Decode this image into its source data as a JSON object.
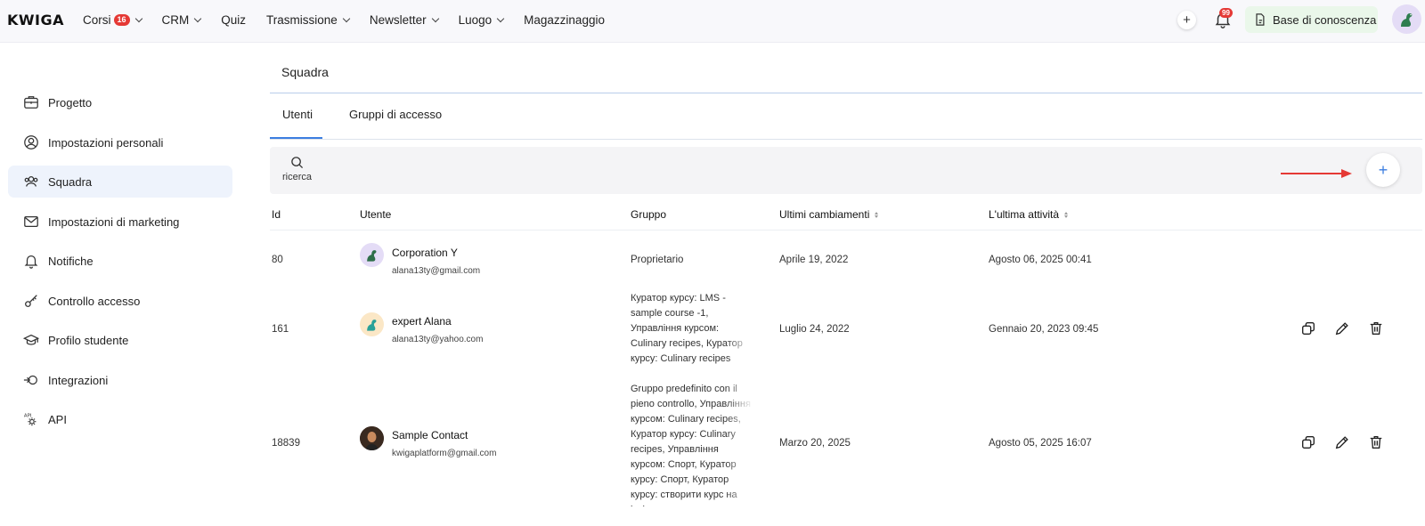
{
  "app": {
    "logo": "KWIGA"
  },
  "nav": {
    "items": [
      {
        "label": "Corsi",
        "badge": "16",
        "chevron": true
      },
      {
        "label": "CRM",
        "chevron": true
      },
      {
        "label": "Quiz"
      },
      {
        "label": "Trasmissione",
        "chevron": true
      },
      {
        "label": "Newsletter",
        "chevron": true
      },
      {
        "label": "Luogo",
        "chevron": true
      },
      {
        "label": "Magazzinaggio"
      }
    ],
    "notifications_badge": "99",
    "knowledge_base_label": "Base di conoscenza",
    "add_icon": "plus-icon",
    "bell_icon": "bell-icon"
  },
  "sidebar": {
    "items": [
      {
        "label": "Progetto",
        "icon": "briefcase-icon"
      },
      {
        "label": "Impostazioni personali",
        "icon": "user-circle-icon"
      },
      {
        "label": "Squadra",
        "icon": "team-icon",
        "active": true
      },
      {
        "label": "Impostazioni di marketing",
        "icon": "mail-icon"
      },
      {
        "label": "Notifiche",
        "icon": "bell-icon"
      },
      {
        "label": "Controllo accesso",
        "icon": "key-icon"
      },
      {
        "label": "Profilo studente",
        "icon": "graduation-cap-icon"
      },
      {
        "label": "Integrazioni",
        "icon": "integration-icon"
      },
      {
        "label": "API",
        "icon": "api-gear-icon"
      }
    ]
  },
  "main": {
    "title": "Squadra",
    "tabs": [
      {
        "label": "Utenti",
        "active": true
      },
      {
        "label": "Gruppi di accesso"
      }
    ],
    "search_label": "ricerca",
    "add_label": "+",
    "accent_color": "#3c7ee0",
    "arrow_color": "#e53935"
  },
  "table": {
    "headers": {
      "id": "Id",
      "user": "Utente",
      "group": "Gruppo",
      "last_changes": "Ultimi cambiamenti",
      "last_activity": "L'ultima attività"
    },
    "rows": [
      {
        "id": "80",
        "name": "Corporation Y",
        "email": "alana13ty@gmail.com",
        "group": "Proprietario",
        "changed": "Aprile 19, 2022",
        "activity": "Agosto 06, 2025 00:41",
        "actions": false
      },
      {
        "id": "161",
        "name": "expert Alana",
        "email": "alana13ty@yahoo.com",
        "group": "Куратор курсу: LMS - sample course -1, Управління курсом: Culinary recipes, Куратор курсу: Culinary recipes",
        "changed": "Luglio 24, 2022",
        "activity": "Gennaio 20, 2023 09:45",
        "actions": true
      },
      {
        "id": "18839",
        "name": "Sample Contact",
        "email": "kwigaplatform@gmail.com",
        "group": "Gruppo predefinito con il pieno controllo, Управління курсом: Culinary recipes, Куратор курсу: Culinary recipes, Управління курсом: Спорт, Куратор курсу: Спорт, Куратор курсу: створити курс на kwiga",
        "changed": "Marzo 20, 2025",
        "activity": "Agosto 05, 2025 16:07",
        "actions": true
      }
    ]
  }
}
